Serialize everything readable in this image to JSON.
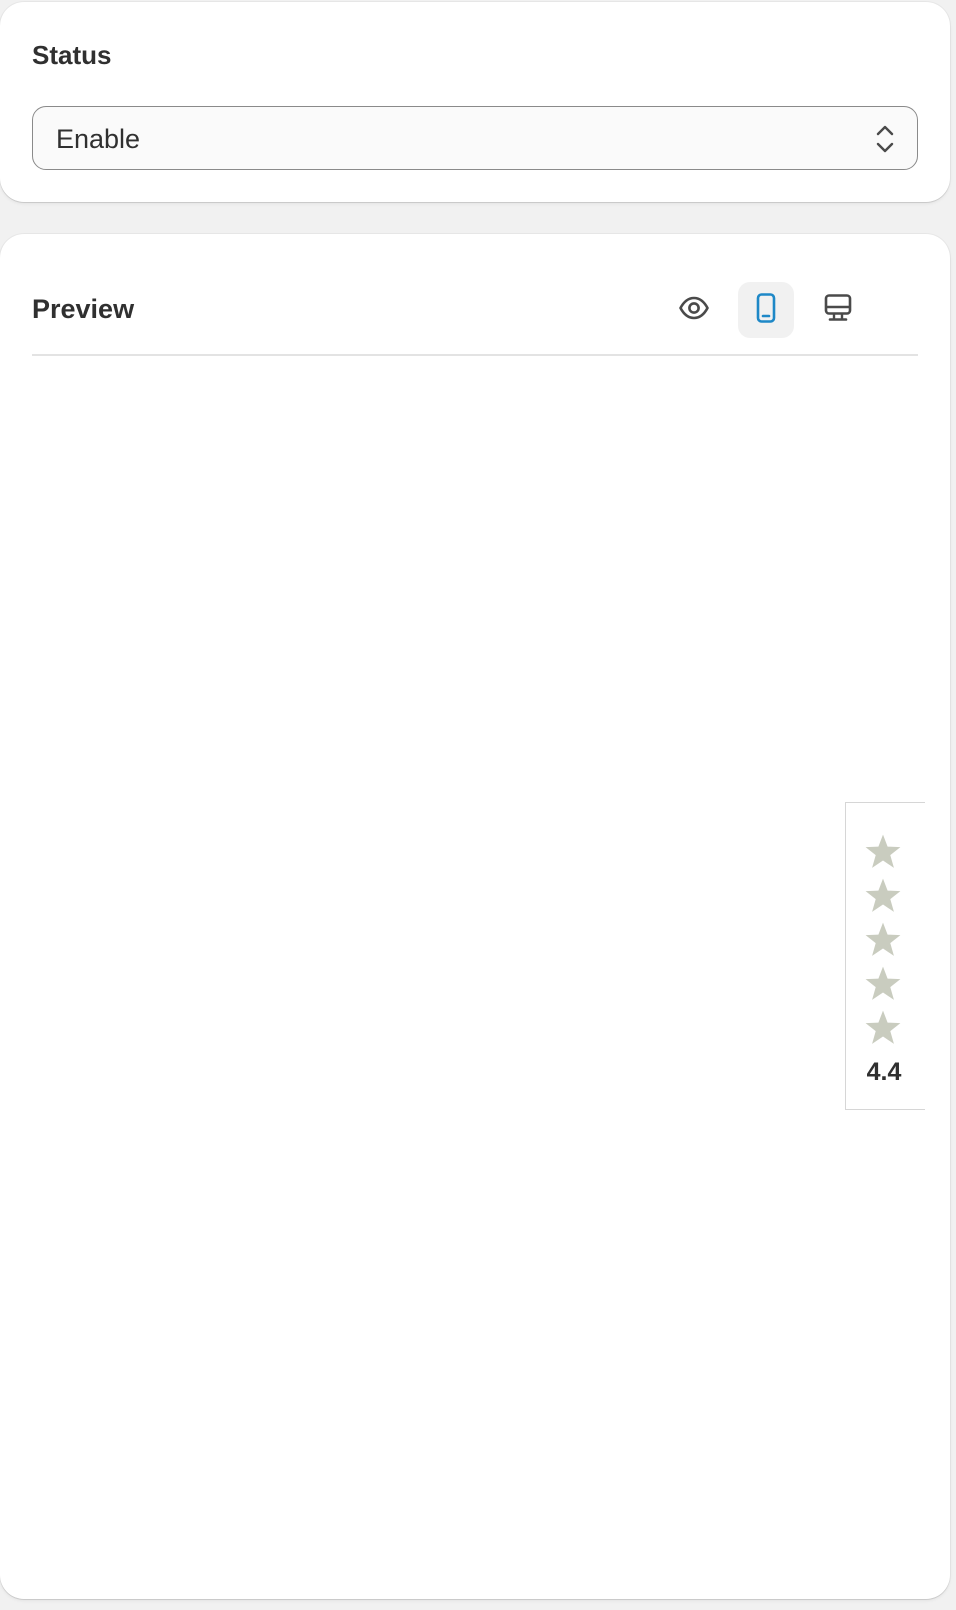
{
  "status_section": {
    "title": "Status",
    "select": {
      "value": "Enable",
      "icon": "select-chevrons-icon"
    }
  },
  "preview_section": {
    "title": "Preview",
    "view_modes": [
      {
        "name": "preview",
        "icon": "eye-icon",
        "active": false
      },
      {
        "name": "mobile",
        "icon": "mobile-icon",
        "active": true
      },
      {
        "name": "desktop",
        "icon": "desktop-icon",
        "active": false
      }
    ],
    "rating_widget": {
      "stars": 5,
      "value": "4.4",
      "star_color": "#c9ccbf"
    }
  },
  "colors": {
    "active_icon": "#1e88c7",
    "icon": "#4a4a4a",
    "page_background": "#f1f1f1",
    "card_background": "#ffffff"
  }
}
